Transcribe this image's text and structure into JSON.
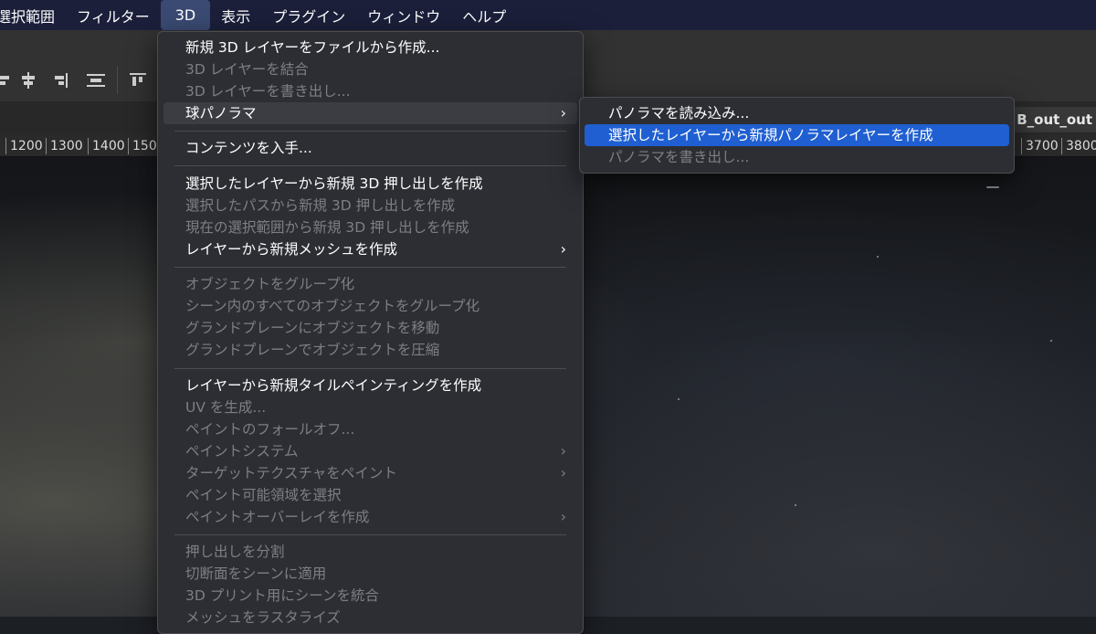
{
  "menubar": {
    "items": [
      {
        "label": "選択範囲"
      },
      {
        "label": "フィルター"
      },
      {
        "label": "3D",
        "active": true
      },
      {
        "label": "表示"
      },
      {
        "label": "プラグイン"
      },
      {
        "label": "ウィンドウ"
      },
      {
        "label": "ヘルプ"
      }
    ]
  },
  "toolbar": {
    "icons": [
      "align-left-icon",
      "align-hcenter-icon",
      "align-right-icon",
      "distribute-icon",
      "align-top-icon"
    ]
  },
  "document": {
    "tab_title": "B_out_out"
  },
  "ruler": {
    "left_ticks": [
      "1200",
      "1300",
      "1400",
      "150"
    ],
    "right_ticks": [
      "3700",
      "3800"
    ]
  },
  "menu_3d": {
    "items": [
      {
        "label": "新規 3D レイヤーをファイルから作成...",
        "enabled": true
      },
      {
        "label": "3D レイヤーを結合",
        "enabled": false
      },
      {
        "label": "3D レイヤーを書き出し...",
        "enabled": false
      },
      {
        "label": "球パノラマ",
        "enabled": true,
        "submenu": true,
        "highlighted": true
      },
      {
        "label": "コンテンツを入手...",
        "enabled": true
      },
      {
        "label": "選択したレイヤーから新規 3D 押し出しを作成",
        "enabled": true
      },
      {
        "label": "選択したパスから新規 3D 押し出しを作成",
        "enabled": false
      },
      {
        "label": "現在の選択範囲から新規 3D 押し出しを作成",
        "enabled": false
      },
      {
        "label": "レイヤーから新規メッシュを作成",
        "enabled": true,
        "submenu": true
      },
      {
        "label": "オブジェクトをグループ化",
        "enabled": false
      },
      {
        "label": "シーン内のすべてのオブジェクトをグループ化",
        "enabled": false
      },
      {
        "label": "グランドプレーンにオブジェクトを移動",
        "enabled": false
      },
      {
        "label": "グランドプレーンでオブジェクトを圧縮",
        "enabled": false
      },
      {
        "label": "レイヤーから新規タイルペインティングを作成",
        "enabled": true
      },
      {
        "label": "UV を生成...",
        "enabled": false
      },
      {
        "label": "ペイントのフォールオフ...",
        "enabled": false
      },
      {
        "label": "ペイントシステム",
        "enabled": false,
        "submenu": true
      },
      {
        "label": "ターゲットテクスチャをペイント",
        "enabled": false,
        "submenu": true
      },
      {
        "label": "ペイント可能領域を選択",
        "enabled": false
      },
      {
        "label": "ペイントオーバーレイを作成",
        "enabled": false,
        "submenu": true
      },
      {
        "label": "押し出しを分割",
        "enabled": false
      },
      {
        "label": "切断面をシーンに適用",
        "enabled": false
      },
      {
        "label": "3D プリント用にシーンを統合",
        "enabled": false
      },
      {
        "label": "メッシュをラスタライズ",
        "enabled": false
      }
    ]
  },
  "submenu_panorama": {
    "items": [
      {
        "label": "パノラマを読み込み...",
        "enabled": true
      },
      {
        "label": "選択したレイヤーから新規パノラマレイヤーを作成",
        "enabled": true,
        "selected": true
      },
      {
        "label": "パノラマを書き出し...",
        "enabled": false
      }
    ]
  },
  "colors": {
    "menubar_bg": "#1b1f3a",
    "menu_bg": "#2c2e33",
    "selection_blue": "#1f5fd1",
    "disabled_text": "#7d7f85"
  }
}
